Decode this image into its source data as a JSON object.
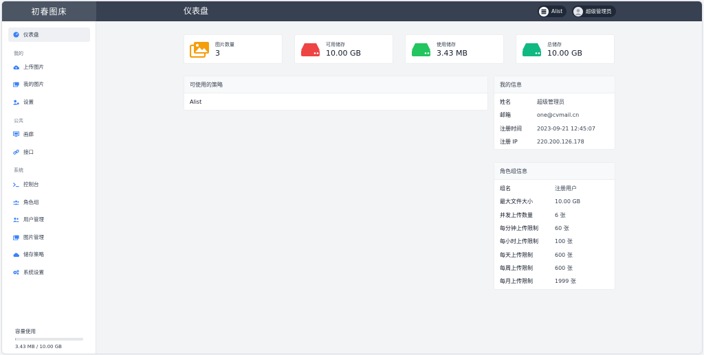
{
  "header": {
    "brand": "初春图床",
    "page_title": "仪表盘",
    "storage_pill": "Alist",
    "user_pill": "超级管理员"
  },
  "sidebar": {
    "top": {
      "label": "仪表盘",
      "icon": "dashboard-icon"
    },
    "sections": [
      {
        "label": "我的",
        "items": [
          {
            "label": "上传图片",
            "icon": "cloud-upload-icon"
          },
          {
            "label": "我的图片",
            "icon": "images-icon"
          },
          {
            "label": "设置",
            "icon": "user-gear-icon"
          }
        ]
      },
      {
        "label": "公共",
        "items": [
          {
            "label": "画廊",
            "icon": "monitor-icon"
          },
          {
            "label": "接口",
            "icon": "link-icon"
          }
        ]
      },
      {
        "label": "系统",
        "items": [
          {
            "label": "控制台",
            "icon": "terminal-icon"
          },
          {
            "label": "角色组",
            "icon": "users-icon"
          },
          {
            "label": "用户管理",
            "icon": "user-group-icon"
          },
          {
            "label": "图片管理",
            "icon": "images-icon"
          },
          {
            "label": "储存策略",
            "icon": "cloud-icon"
          },
          {
            "label": "系统设置",
            "icon": "gears-icon"
          }
        ]
      }
    ],
    "usage": {
      "label": "容量使用",
      "text": "3.43 MB / 10.00 GB",
      "fraction": 0.0003
    }
  },
  "stats": [
    {
      "label": "图片数量",
      "value": "3",
      "icon": "images-icon",
      "color": "#f59e0b"
    },
    {
      "label": "可用储存",
      "value": "10.00 GB",
      "icon": "hard-drive-icon",
      "color": "#ef4444"
    },
    {
      "label": "使用储存",
      "value": "3.43 MB",
      "icon": "hard-drive-icon",
      "color": "#22c55e"
    },
    {
      "label": "总储存",
      "value": "10.00 GB",
      "icon": "hard-drive-icon",
      "color": "#10b981"
    }
  ],
  "strategies": {
    "title": "可使用的策略",
    "items": [
      "Alist"
    ]
  },
  "my_info": {
    "title": "我的信息",
    "rows": [
      {
        "k": "姓名",
        "v": "超级管理员"
      },
      {
        "k": "邮箱",
        "v": "one@cvmail.cn"
      },
      {
        "k": "注册时间",
        "v": "2023-09-21 12:45:07"
      },
      {
        "k": "注册 IP",
        "v": "220.200.126.178"
      }
    ]
  },
  "role_info": {
    "title": "角色组信息",
    "rows": [
      {
        "k": "组名",
        "v": "注册用户"
      },
      {
        "k": "最大文件大小",
        "v": "10.00 GB"
      },
      {
        "k": "并发上传数量",
        "v": "6 张"
      },
      {
        "k": "每分钟上传限制",
        "v": "60 张"
      },
      {
        "k": "每小时上传限制",
        "v": "100 张"
      },
      {
        "k": "每天上传限制",
        "v": "600 张"
      },
      {
        "k": "每周上传限制",
        "v": "600 张"
      },
      {
        "k": "每月上传限制",
        "v": "1999 张"
      }
    ]
  },
  "colors": {
    "header": "#374151",
    "brand_bg": "#4b5563",
    "nav_icon": "#3b82f6"
  }
}
